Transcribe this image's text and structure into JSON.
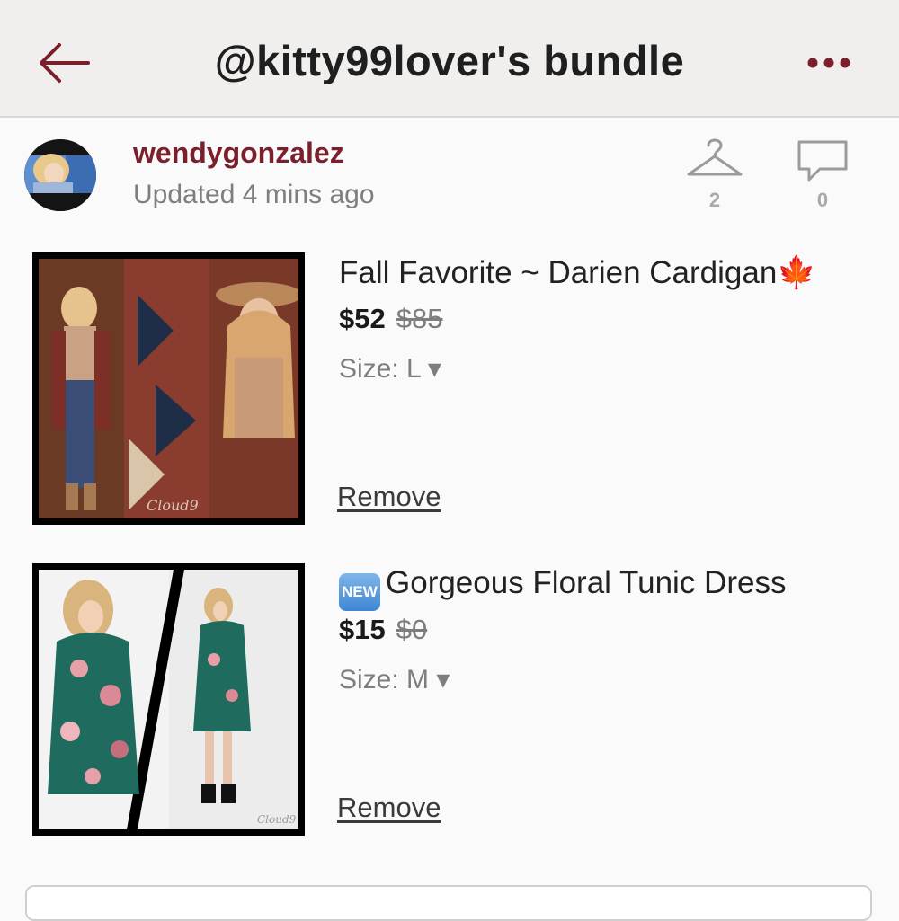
{
  "header": {
    "title": "@kitty99lover's bundle",
    "back_icon": "back-arrow-icon",
    "more_icon": "more-dots-icon",
    "accent_color": "#7a1f2b"
  },
  "seller": {
    "username": "wendygonzalez",
    "updated": "Updated 4 mins ago",
    "likes_count": "2",
    "comments_count": "0"
  },
  "items": [
    {
      "title": "Fall Favorite ~ Darien Cardigan",
      "title_emoji": "🍁",
      "price": "$52",
      "original_price": "$85",
      "size": "Size: L ▾",
      "remove": "Remove",
      "watermark": "Cloud9"
    },
    {
      "badge": "NEW",
      "title": "Gorgeous Floral Tunic Dress",
      "price": "$15",
      "original_price": "$0",
      "size": "Size: M ▾",
      "remove": "Remove",
      "watermark": "Cloud9"
    }
  ]
}
